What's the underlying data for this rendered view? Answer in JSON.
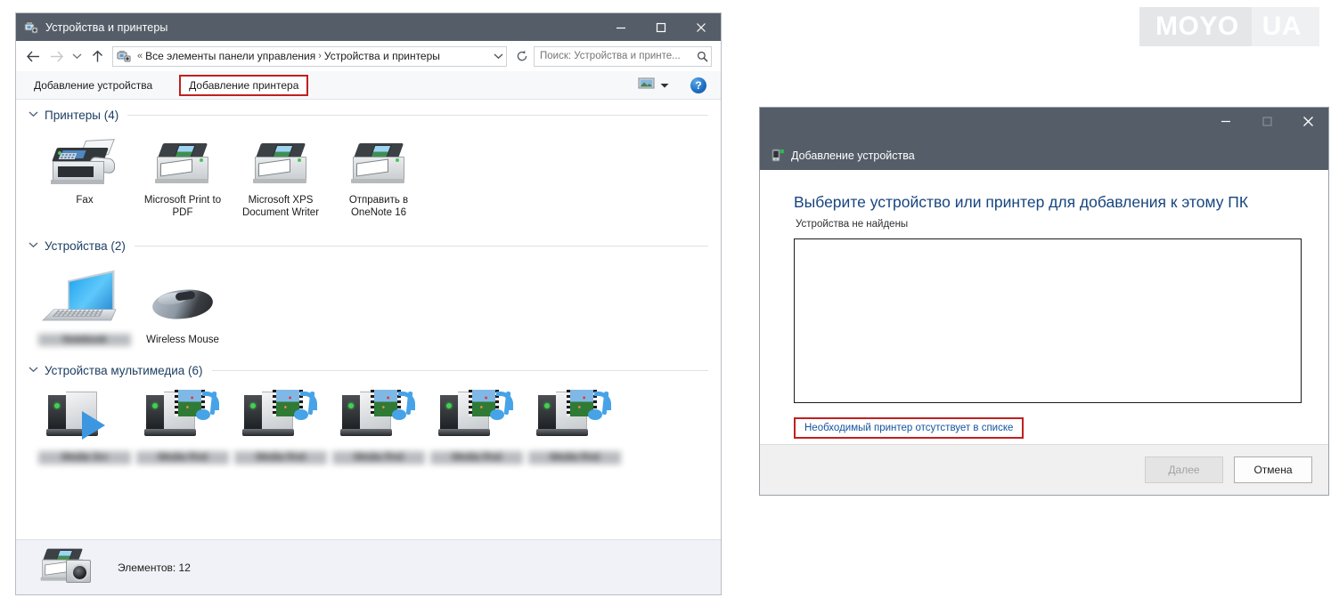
{
  "explorer": {
    "title": "Устройства и принтеры",
    "title_icon": "devices-printers-icon",
    "window_controls": {
      "minimize": "minimize-icon",
      "maximize": "maximize-icon",
      "close": "close-icon"
    },
    "nav": {
      "back": "back-arrow-icon",
      "forward": "forward-arrow-icon",
      "recent": "chevron-down-icon",
      "up": "up-arrow-icon"
    },
    "address": {
      "icon": "devices-printers-icon",
      "overflow": "«",
      "crumb1": "Все элементы панели управления",
      "separator": "›",
      "crumb2": "Устройства и принтеры",
      "dropdown": "chevron-down-icon",
      "refresh": "refresh-icon"
    },
    "search": {
      "placeholder": "Поиск: Устройства и принте...",
      "value": "",
      "icon": "search-icon"
    },
    "commandbar": {
      "add_device": "Добавление устройства",
      "add_printer": "Добавление принтера",
      "view_icon": "view-pane-icon",
      "view_dropdown": "chevron-down-icon",
      "help": "?"
    },
    "groups": [
      {
        "name": "printers-group",
        "title": "Принтеры (4)",
        "chevron": "chevron-down-icon",
        "items": [
          {
            "label": "Fax",
            "icon": "fax-printer-icon",
            "blurred": false
          },
          {
            "label": "Microsoft Print to PDF",
            "icon": "printer-icon",
            "blurred": false
          },
          {
            "label": "Microsoft XPS Document Writer",
            "icon": "printer-icon",
            "blurred": false
          },
          {
            "label": "Отправить в OneNote 16",
            "icon": "printer-icon",
            "blurred": false
          }
        ]
      },
      {
        "name": "devices-group",
        "title": "Устройства (2)",
        "chevron": "chevron-down-icon",
        "items": [
          {
            "label": "",
            "icon": "laptop-icon",
            "blurred": true
          },
          {
            "label": "Wireless Mouse",
            "icon": "mouse-icon",
            "blurred": false
          }
        ]
      },
      {
        "name": "multimedia-group",
        "title": "Устройства мультимедиа (6)",
        "chevron": "chevron-down-icon",
        "items": [
          {
            "label": "",
            "icon": "media-player-icon",
            "blurred": true
          },
          {
            "label": "",
            "icon": "media-renderer-icon",
            "blurred": true
          },
          {
            "label": "",
            "icon": "media-renderer-icon",
            "blurred": true
          },
          {
            "label": "",
            "icon": "media-renderer-icon",
            "blurred": true
          },
          {
            "label": "",
            "icon": "media-renderer-icon",
            "blurred": true
          },
          {
            "label": "",
            "icon": "media-renderer-icon",
            "blurred": true
          }
        ]
      }
    ],
    "statusbar": {
      "icon": "printer-camera-icon",
      "text": "Элементов: 12"
    }
  },
  "dialog": {
    "title": "Добавление устройства",
    "title_icon": "add-device-icon",
    "window_controls": {
      "minimize": "minimize-icon",
      "maximize": "maximize-icon",
      "close": "close-icon"
    },
    "heading": "Выберите устройство или принтер для добавления к этому ПК",
    "subtext": "Устройства не найдены",
    "list_items": [],
    "link": "Необходимый принтер отсутствует в списке",
    "buttons": {
      "next": "Далее",
      "next_disabled": true,
      "cancel": "Отмена",
      "cancel_disabled": false
    }
  },
  "watermark": {
    "part1": "MOYO",
    "part2": "UA"
  },
  "colors": {
    "titlebar": "#555e68",
    "accent_red": "#c02020",
    "link_blue": "#14539e",
    "heading_blue": "#17457f",
    "group_title": "#1d3f63",
    "statusbar_bg": "#f1f2f7"
  }
}
